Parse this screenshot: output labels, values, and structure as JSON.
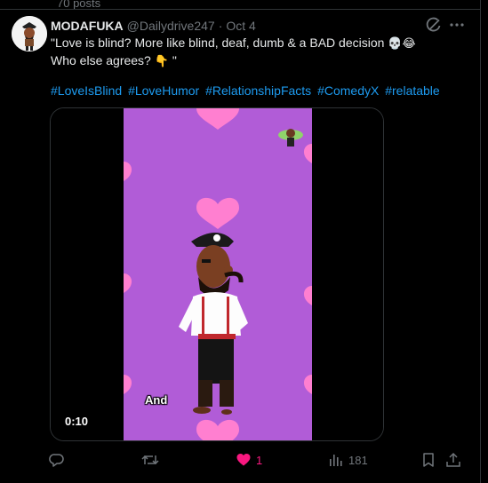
{
  "profile": {
    "posts_count": "70 posts"
  },
  "tweet": {
    "author": "MODAFUKA",
    "handle": "@Dailydrive247",
    "separator": "·",
    "date": "Oct 4",
    "text_line1": "\"Love is blind? More like blind, deaf, dumb & a BAD decision",
    "emoji1": "💀😂",
    "text_line2": "Who else agrees?",
    "emoji2": "👇",
    "text_line2_end": "\"",
    "hashtags": [
      "#LoveIsBlind",
      "#LoveHumor",
      "#RelationshipFacts",
      "#ComedyX",
      "#relatable"
    ]
  },
  "video": {
    "timestamp": "0:10",
    "caption": "And",
    "bg_color": "#b15cd7",
    "heart_color": "#ff7fd0"
  },
  "actions": {
    "reply_count": "",
    "repost_count": "",
    "like_count": "1",
    "views_count": "181"
  },
  "icons": [
    "avatar",
    "grok-icon",
    "more-icon",
    "reply-icon",
    "repost-icon",
    "like-icon",
    "views-icon",
    "bookmark-icon",
    "share-icon"
  ]
}
